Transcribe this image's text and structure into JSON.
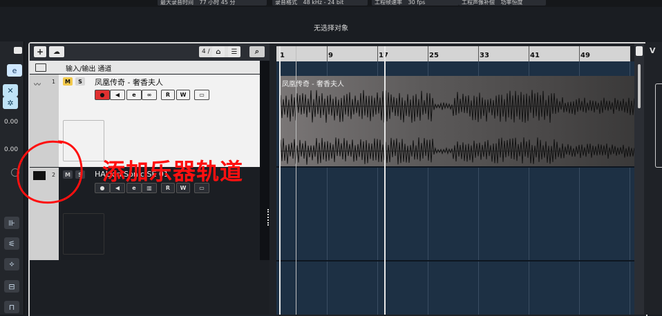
{
  "statusbar": {
    "items": [
      {
        "label": "最大录音时间",
        "value": "77 小时 45 分"
      },
      {
        "label": "录音格式",
        "value": "48 kHz - 24 bit"
      },
      {
        "label": "工程帧速率",
        "value": "30 fps"
      },
      {
        "label": "工程声像补偿",
        "value": "功率恒度"
      }
    ]
  },
  "info_line": {
    "text": "无选择对象"
  },
  "inspector": {
    "values": [
      "0.00",
      "0.00"
    ]
  },
  "toolbar": {
    "add": "+",
    "counter": "4 / 4"
  },
  "tracks": [
    {
      "number": "1",
      "name": "凤凰传奇 - 奢香夫人",
      "m": "M",
      "s": "S",
      "r": "R",
      "w": "W"
    },
    {
      "number": "2",
      "name": "HALion Sonic SE 01",
      "m": "M",
      "s": "S",
      "r": "R",
      "w": "W"
    }
  ],
  "io_channel": {
    "label": "输入/输出 通道"
  },
  "ruler": {
    "bars": [
      "1",
      "9",
      "17",
      "25",
      "33",
      "41",
      "49"
    ]
  },
  "event": {
    "title": "凤凰传奇 - 奢香夫人"
  },
  "annotation": {
    "text": "添加乐器轨道"
  },
  "colors": {
    "arrange_bg": "#1d3044",
    "annotation": "#ff1010",
    "mute": "#f2c94c"
  }
}
